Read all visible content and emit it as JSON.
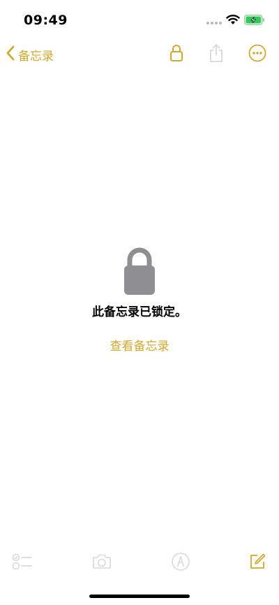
{
  "status_bar": {
    "time": "09:49"
  },
  "nav": {
    "back_label": "备忘录"
  },
  "locked": {
    "message": "此备忘录已锁定。",
    "view_label": "查看备忘录"
  },
  "icons": {
    "back": "chevron-left-icon",
    "lock": "lock-icon",
    "share": "share-icon",
    "more": "ellipsis-circle-icon",
    "checklist": "checklist-icon",
    "camera": "camera-icon",
    "markup": "markup-pen-icon",
    "compose": "compose-icon"
  },
  "colors": {
    "accent": "#d1a72d",
    "disabled": "#d9d9d9",
    "lock_gray": "#8e8e93",
    "battery_green": "#34c759"
  }
}
